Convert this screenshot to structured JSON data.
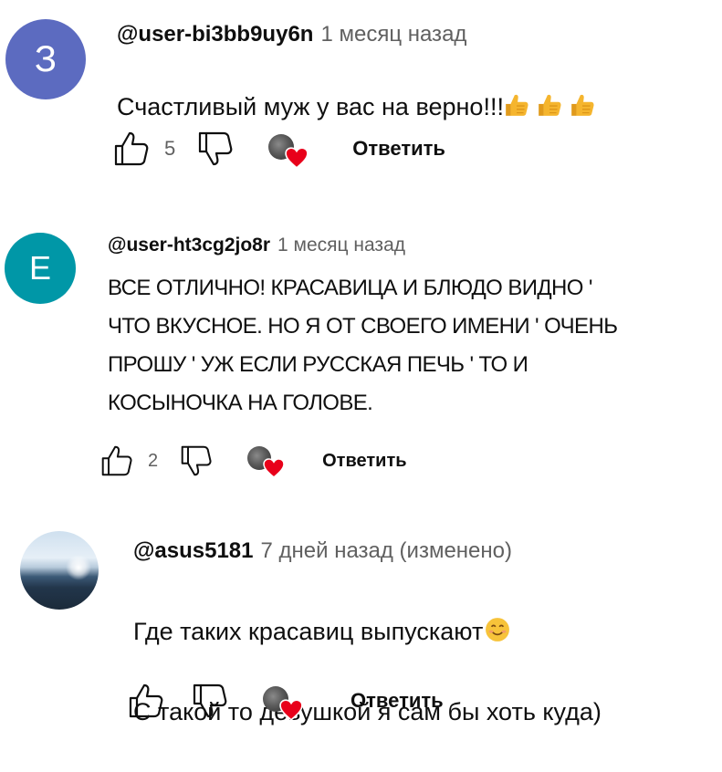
{
  "comments": [
    {
      "avatar_letter": "З",
      "avatar_color": "#5c6bc0",
      "author": "@user-bi3bb9uy6n",
      "time": "1 месяц назад",
      "text": "Счастливый муж у вас на верно!!!",
      "emoji_icons": [
        "thumbs-up-emoji",
        "thumbs-up-emoji",
        "thumbs-up-emoji"
      ],
      "likes": "5",
      "reply_label": "Ответить"
    },
    {
      "avatar_letter": "Е",
      "avatar_color": "#0097a7",
      "author": "@user-ht3cg2jo8r",
      "time": "1 месяц назад",
      "text": "ВСЕ ОТЛИЧНО! КРАСАВИЦА И БЛЮДО ВИДНО '\nЧТО ВКУСНОЕ. НО Я ОТ СВОЕГО ИМЕНИ ' ОЧЕНЬ\nПРОШУ ' УЖ ЕСЛИ РУССКАЯ ПЕЧЬ '  ТО И\nКОСЫНОЧКА НА ГОЛОВЕ.",
      "likes": "2",
      "reply_label": "Ответить"
    },
    {
      "avatar_icon": "sea-photo-avatar",
      "author": "@asus5181",
      "time": "7 дней назад (изменено)",
      "text_line1": "Где таких красавиц выпускают",
      "text_line1_emoji": "smiling-face-emoji",
      "text_line2": "С такой то девушкой я сам бы хоть куда)",
      "likes": "",
      "reply_label": "Ответить"
    }
  ],
  "icons": {
    "like": "thumb-up-icon",
    "dislike": "thumb-down-icon",
    "creator_heart": "creator-heart-badge"
  },
  "colors": {
    "heart": "#e8001a",
    "emoji_yellow": "#f5b52e"
  }
}
